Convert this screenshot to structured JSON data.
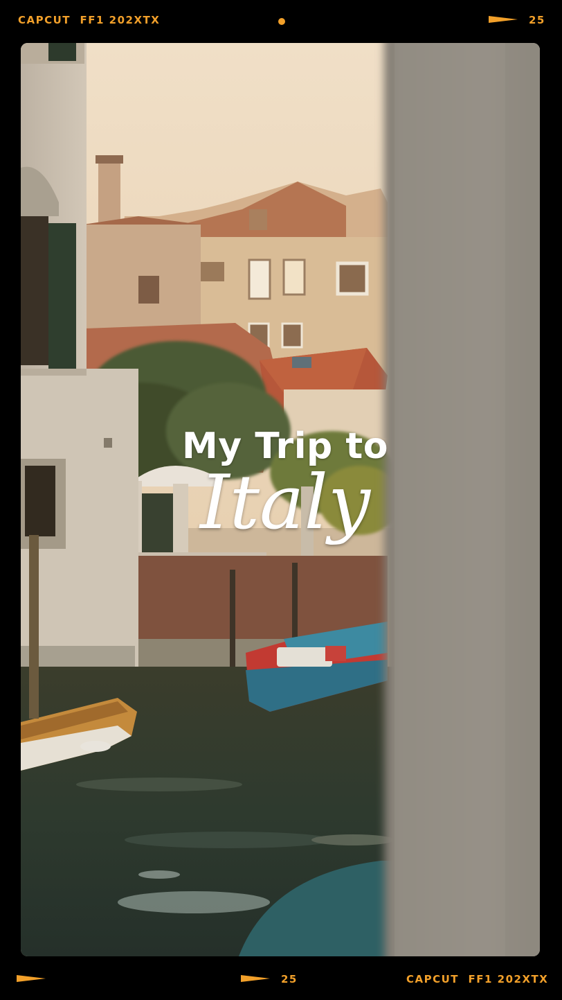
{
  "film_strip": {
    "top_left_label": "CAPCUT  FF1 202XTX",
    "top_right_number": "25",
    "bottom_center_number": "25",
    "bottom_right_label": "CAPCUT  FF1 202XTX",
    "accent_color": "#f2a02a"
  },
  "photo": {
    "title_line1": "My Trip to",
    "title_line2": "Italy"
  }
}
